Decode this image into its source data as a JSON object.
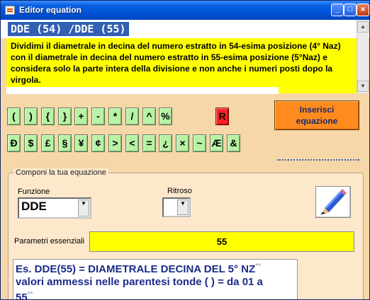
{
  "window": {
    "title": "Editor equation"
  },
  "title_buttons": {
    "minimize": "_",
    "maximize": "□",
    "close": "×"
  },
  "formula": "DDE (54) /DDE (55)",
  "description": "Dividimi il diametrale in decina del numero estratto in 54-esima posizione (4° Naz) con il diametrale in decina del numero estratto in 55-esima posizione (5°Naz) e considera solo la parte intera della divisione e non anche i numeri posti dopo la virgola.",
  "symbols_row1": [
    "(",
    ")",
    "{",
    "}",
    "+",
    "-",
    "*",
    "/",
    "^",
    "%"
  ],
  "symbol_r": "R",
  "symbols_row2": [
    "Đ",
    "$",
    "£",
    "§",
    "¥",
    "¢",
    ">",
    "<",
    "=",
    "¿",
    "×",
    "~",
    "Æ",
    "&"
  ],
  "insert_button": {
    "line1": "Inserisci",
    "line2": "equazione"
  },
  "compose": {
    "legend": "Componi la tua equazione",
    "funzione_label": "Funzione",
    "funzione_value": "DDE",
    "ritroso_label": "Ritroso",
    "ritroso_value": "",
    "param_label": "Parametri essenziali",
    "param_value": "55"
  },
  "example": {
    "line1": "Es. DDE(55)  =  DIAMETRALE DECINA DEL 5° NZ",
    "line2": "valori ammessi  nelle parentesi tonde ( ) = da 01 a",
    "line3": "55",
    "asterisks": "**"
  },
  "colors": {
    "accent": "#3160b4",
    "highlight": "#ffff00",
    "button_green": "#b8f2a4",
    "button_red": "#ff2020",
    "insert_orange": "#ff8a1e",
    "panel_bg": "#f5d7a8"
  },
  "icons": {
    "pencil": "pencil-icon"
  }
}
